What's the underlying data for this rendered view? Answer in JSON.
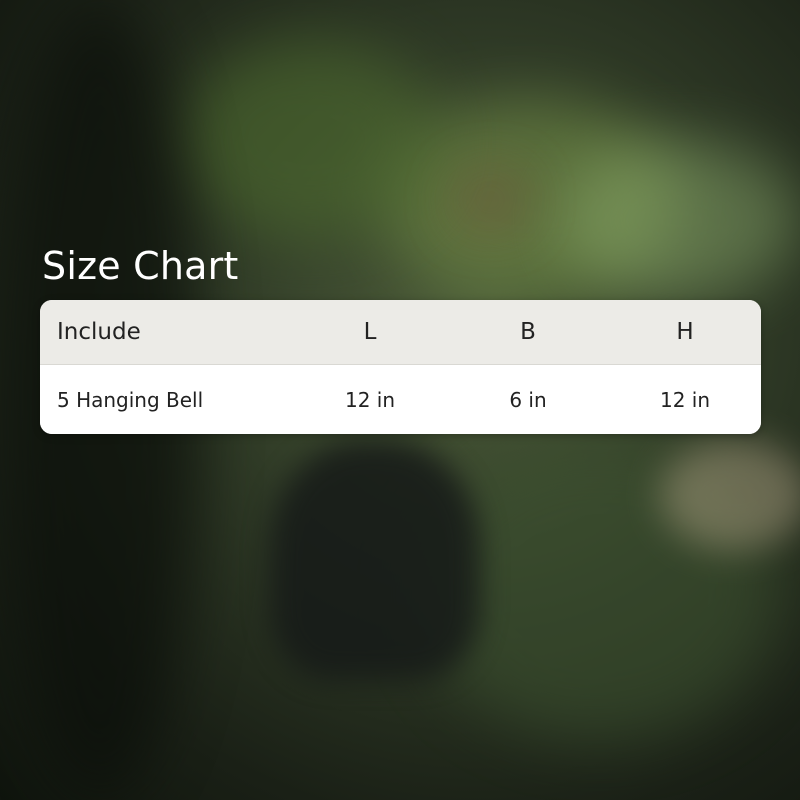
{
  "title": "Size Chart",
  "table": {
    "headers": [
      "Include",
      "L",
      "B",
      "H"
    ],
    "rows": [
      [
        "5 Hanging Bell",
        "12 in",
        "6 in",
        "12 in"
      ]
    ]
  }
}
